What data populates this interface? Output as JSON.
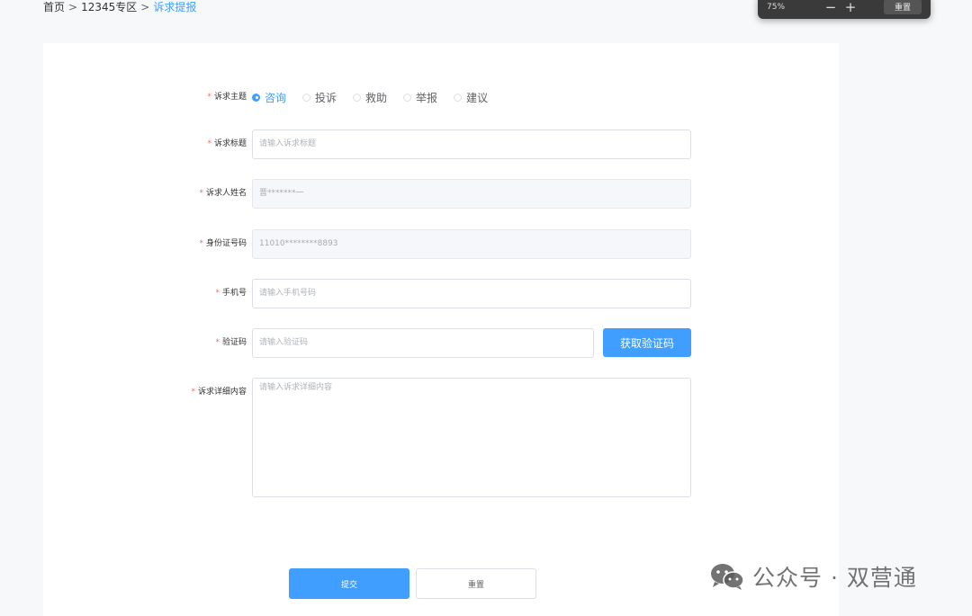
{
  "breadcrumb": {
    "home": "首页",
    "section": "12345专区",
    "current": "诉求提报",
    "separator": ">"
  },
  "zoom_toolbar": {
    "level": "75%",
    "zoom_out": "−",
    "zoom_in": "+",
    "reset": "重置"
  },
  "form": {
    "required_mark": "*",
    "topic": {
      "label": "诉求主题",
      "options": [
        "咨询",
        "投诉",
        "救助",
        "举报",
        "建议"
      ],
      "selected": "咨询"
    },
    "title": {
      "label": "诉求标题",
      "placeholder": "请输入诉求标题"
    },
    "name": {
      "label": "诉求人姓名",
      "value": "晋*******一"
    },
    "id_number": {
      "label": "身份证号码",
      "value": "11010********8893"
    },
    "phone": {
      "label": "手机号",
      "placeholder": "请输入手机号码"
    },
    "code": {
      "label": "验证码",
      "placeholder": "请输入验证码",
      "button": "获取验证码"
    },
    "detail": {
      "label": "诉求详细内容",
      "placeholder": "请输入诉求详细内容"
    },
    "submit": "提交",
    "reset": "重置"
  },
  "watermark": {
    "text": "公众号 · 双营通",
    "icon": "wechat-icon"
  },
  "colors": {
    "primary": "#409eff",
    "required": "#f56c6c",
    "border": "#dcdfe6"
  }
}
